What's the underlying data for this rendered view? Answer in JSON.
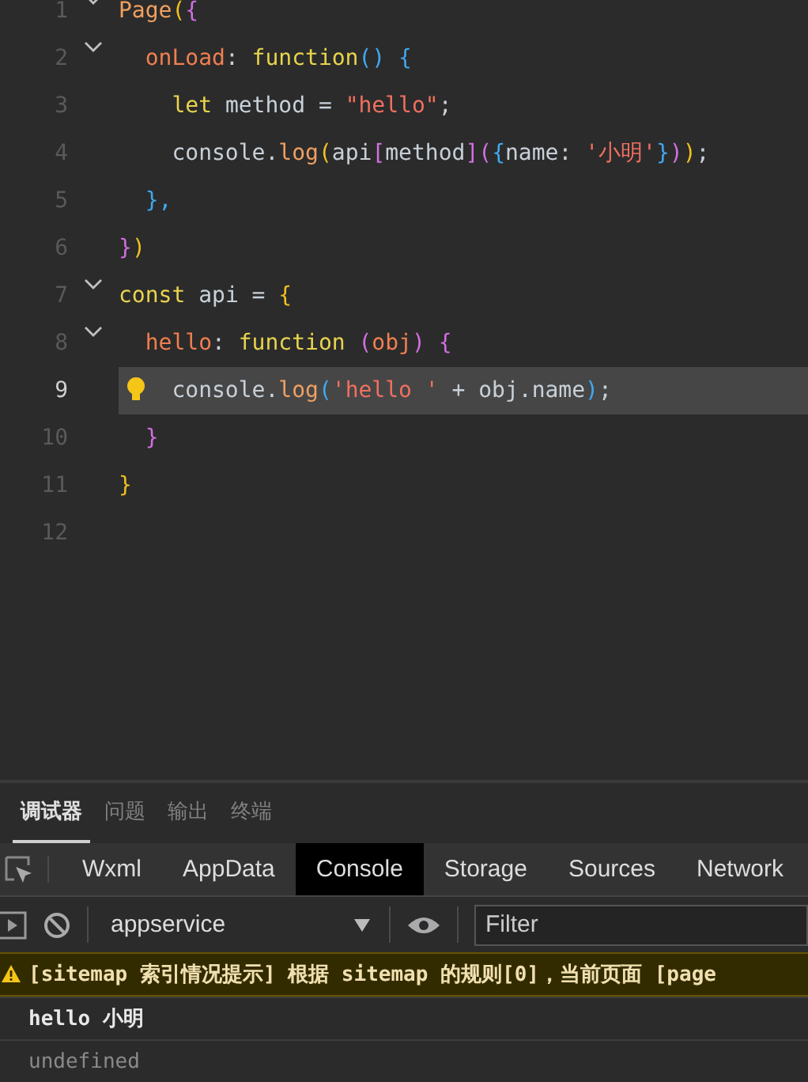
{
  "editor": {
    "lines": [
      {
        "number": "1",
        "fold": true,
        "current": false,
        "tokens": [
          {
            "t": "Page",
            "color": "#f0a060"
          },
          {
            "t": "(",
            "color": "#f0c020"
          },
          {
            "t": "{",
            "color": "#d070e0"
          }
        ]
      },
      {
        "number": "2",
        "fold": true,
        "current": false,
        "tokens": [
          {
            "t": "  onLoad",
            "color": "#f07f50"
          },
          {
            "t": ": ",
            "color": "#c8d0d8"
          },
          {
            "t": "function",
            "color": "#e8d44d"
          },
          {
            "t": "() {",
            "color": "#40a8f0"
          }
        ]
      },
      {
        "number": "3",
        "fold": false,
        "current": false,
        "tokens": [
          {
            "t": "    let",
            "color": "#e8d44d"
          },
          {
            "t": " method = ",
            "color": "#c8d0d8"
          },
          {
            "t": "\"hello\"",
            "color": "#f07060"
          },
          {
            "t": ";",
            "color": "#c8d0d8"
          }
        ]
      },
      {
        "number": "4",
        "fold": false,
        "current": false,
        "tokens": [
          {
            "t": "    console.",
            "color": "#c8d0d8"
          },
          {
            "t": "log",
            "color": "#f0a060"
          },
          {
            "t": "(",
            "color": "#f0c020"
          },
          {
            "t": "api",
            "color": "#c8d0d8"
          },
          {
            "t": "[",
            "color": "#d070e0"
          },
          {
            "t": "method",
            "color": "#c8d0d8"
          },
          {
            "t": "](",
            "color": "#d070e0"
          },
          {
            "t": "{",
            "color": "#40a8f0"
          },
          {
            "t": "name: ",
            "color": "#c8d0d8"
          },
          {
            "t": "'小明'",
            "color": "#f07060"
          },
          {
            "t": "}",
            "color": "#40a8f0"
          },
          {
            "t": ")",
            "color": "#d070e0"
          },
          {
            "t": ")",
            "color": "#f0c020"
          },
          {
            "t": ";",
            "color": "#c8d0d8"
          }
        ]
      },
      {
        "number": "5",
        "fold": false,
        "current": false,
        "tokens": [
          {
            "t": "  },",
            "color": "#40a8f0"
          }
        ]
      },
      {
        "number": "6",
        "fold": false,
        "current": false,
        "tokens": [
          {
            "t": "}",
            "color": "#d070e0"
          },
          {
            "t": ")",
            "color": "#f0c020"
          }
        ]
      },
      {
        "number": "7",
        "fold": true,
        "current": false,
        "tokens": [
          {
            "t": "const",
            "color": "#e8d44d"
          },
          {
            "t": " api = ",
            "color": "#c8d0d8"
          },
          {
            "t": "{",
            "color": "#f0c020"
          }
        ]
      },
      {
        "number": "8",
        "fold": true,
        "current": false,
        "tokens": [
          {
            "t": "  hello",
            "color": "#f07f50"
          },
          {
            "t": ": ",
            "color": "#c8d0d8"
          },
          {
            "t": "function ",
            "color": "#e8d44d"
          },
          {
            "t": "(",
            "color": "#d070e0"
          },
          {
            "t": "obj",
            "color": "#f07f50"
          },
          {
            "t": ") {",
            "color": "#d070e0"
          }
        ]
      },
      {
        "number": "9",
        "fold": false,
        "current": true,
        "tokens": [
          {
            "t": "    console.",
            "color": "#c8d0d8"
          },
          {
            "t": "log",
            "color": "#f0a060"
          },
          {
            "t": "(",
            "color": "#40a8f0"
          },
          {
            "t": "'hello '",
            "color": "#f07060"
          },
          {
            "t": " + obj.name",
            "color": "#c8d0d8"
          },
          {
            "t": ")",
            "color": "#40a8f0"
          },
          {
            "t": ";",
            "color": "#c8d0d8"
          }
        ]
      },
      {
        "number": "10",
        "fold": false,
        "current": false,
        "tokens": [
          {
            "t": "  }",
            "color": "#d070e0"
          }
        ]
      },
      {
        "number": "11",
        "fold": false,
        "current": false,
        "tokens": [
          {
            "t": "}",
            "color": "#f0c020"
          }
        ]
      },
      {
        "number": "12",
        "fold": false,
        "current": false
      }
    ]
  },
  "panel_tabs": [
    {
      "label": "调试器",
      "selected": true
    },
    {
      "label": "问题",
      "selected": false
    },
    {
      "label": "输出",
      "selected": false
    },
    {
      "label": "终端",
      "selected": false
    }
  ],
  "devtools_tabs": [
    {
      "label": "Wxml",
      "selected": false
    },
    {
      "label": "AppData",
      "selected": false
    },
    {
      "label": "Console",
      "selected": true
    },
    {
      "label": "Storage",
      "selected": false
    },
    {
      "label": "Sources",
      "selected": false
    },
    {
      "label": "Network",
      "selected": false
    }
  ],
  "toolbar": {
    "context": "appservice",
    "filter": {
      "placeholder": "Filter"
    }
  },
  "console": [
    {
      "kind": "warning",
      "text": "[sitemap 索引情况提示] 根据 sitemap 的规则[0]，当前页面 [page"
    },
    {
      "kind": "log",
      "text": "hello 小明"
    },
    {
      "kind": "result",
      "text": "undefined"
    }
  ]
}
